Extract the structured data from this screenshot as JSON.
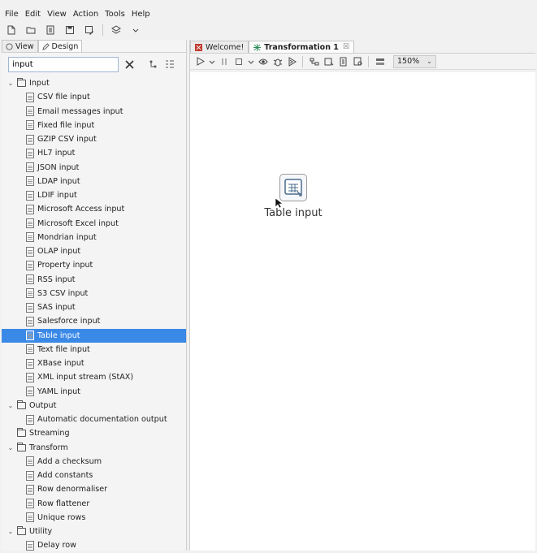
{
  "menubar": [
    "File",
    "Edit",
    "View",
    "Action",
    "Tools",
    "Help"
  ],
  "left_panel": {
    "tabs": [
      "View",
      "Design"
    ],
    "active_tab": "Design",
    "search": {
      "value": "input"
    }
  },
  "tree": [
    {
      "type": "cat",
      "label": "Input",
      "expanded": true
    },
    {
      "type": "step",
      "label": "CSV file input"
    },
    {
      "type": "step",
      "label": "Email messages input"
    },
    {
      "type": "step",
      "label": "Fixed file input"
    },
    {
      "type": "step",
      "label": "GZIP CSV input"
    },
    {
      "type": "step",
      "label": "HL7 input"
    },
    {
      "type": "step",
      "label": "JSON input"
    },
    {
      "type": "step",
      "label": "LDAP input"
    },
    {
      "type": "step",
      "label": "LDIF input"
    },
    {
      "type": "step",
      "label": "Microsoft Access input"
    },
    {
      "type": "step",
      "label": "Microsoft Excel input"
    },
    {
      "type": "step",
      "label": "Mondrian input"
    },
    {
      "type": "step",
      "label": "OLAP input"
    },
    {
      "type": "step",
      "label": "Property input"
    },
    {
      "type": "step",
      "label": "RSS input"
    },
    {
      "type": "step",
      "label": "S3 CSV input"
    },
    {
      "type": "step",
      "label": "SAS input"
    },
    {
      "type": "step",
      "label": "Salesforce input"
    },
    {
      "type": "step",
      "label": "Table input",
      "selected": true
    },
    {
      "type": "step",
      "label": "Text file input"
    },
    {
      "type": "step",
      "label": "XBase input"
    },
    {
      "type": "step",
      "label": "XML input stream (StAX)"
    },
    {
      "type": "step",
      "label": "YAML input"
    },
    {
      "type": "cat",
      "label": "Output",
      "expanded": true
    },
    {
      "type": "step",
      "label": "Automatic documentation output"
    },
    {
      "type": "cat",
      "label": "Streaming",
      "expanded": false
    },
    {
      "type": "cat",
      "label": "Transform",
      "expanded": true
    },
    {
      "type": "step",
      "label": "Add a checksum"
    },
    {
      "type": "step",
      "label": "Add constants"
    },
    {
      "type": "step",
      "label": "Row denormaliser"
    },
    {
      "type": "step",
      "label": "Row flattener"
    },
    {
      "type": "step",
      "label": "Unique rows"
    },
    {
      "type": "cat",
      "label": "Utility",
      "expanded": true
    },
    {
      "type": "step",
      "label": "Delay row"
    }
  ],
  "editor": {
    "tabs": [
      {
        "label": "Welcome!",
        "active": false,
        "closable": false
      },
      {
        "label": "Transformation 1",
        "active": true,
        "closable": true
      }
    ],
    "zoom": "150%",
    "canvas_step": {
      "label": "Table input",
      "icon": "table-input-icon"
    }
  },
  "colors": {
    "selection": "#3b89e6",
    "canvas": "#ffffff",
    "accent_tab_icon": "#c0392b"
  }
}
